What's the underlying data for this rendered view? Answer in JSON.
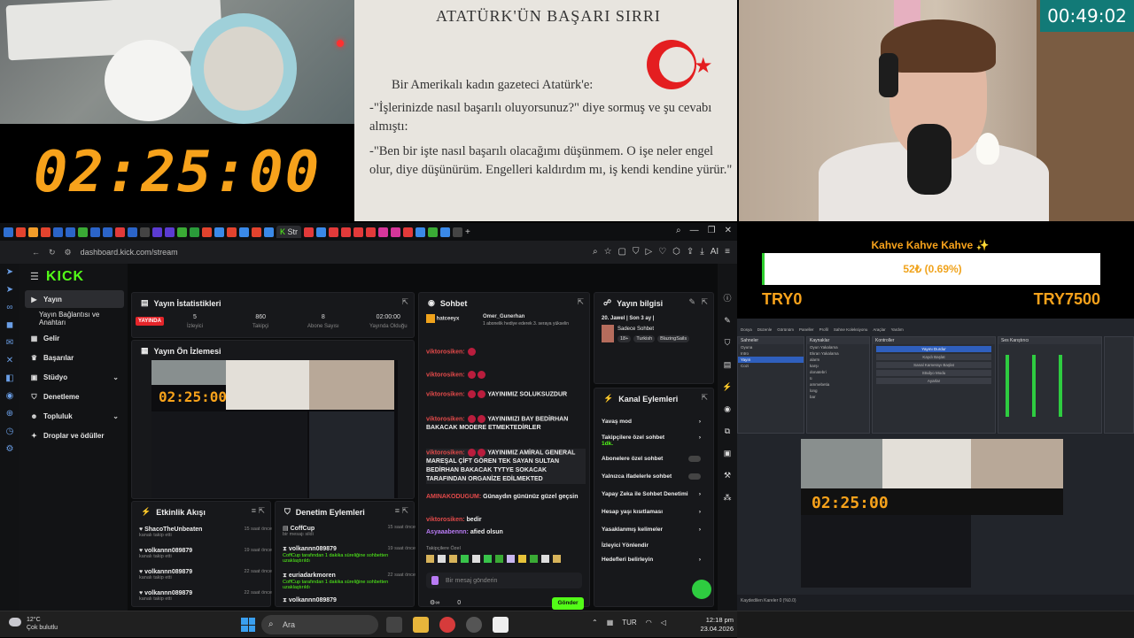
{
  "overlay": {
    "big_timer": "02:25:00",
    "small_clock": "00:49:02",
    "book": {
      "title": "ATATÜRK'ÜN BAŞARI SIRRI",
      "p1": "Bir Amerikalı kadın gazeteci Atatürk'e:",
      "p2": "-\"İşlerinizde nasıl başarılı oluyorsunuz?\" diye sormuş ve şu cevabı almıştı:",
      "p3": "-\"Ben bir işte nasıl başarılı olacağımı düşünmem. O işe neler engel olur, diye düşünürüm. Engelleri kaldırdım mı, iş kendi kendine yürür.\""
    },
    "donation": {
      "title": "Kahve Kahve Kahve ✨",
      "progress_text": "52₺ (0.69%)",
      "progress_fraction": 0.0069,
      "min_label": "TRY0",
      "max_label": "TRY7500"
    }
  },
  "browser": {
    "active_tab": "Str",
    "url": "dashboard.kick.com/stream",
    "logo": "KICK",
    "sidebar": {
      "items": [
        {
          "label": "Yayın",
          "icon": "play-icon",
          "active": true
        },
        {
          "label": "Yayın Bağlantısı ve Anahtarı",
          "icon": "",
          "active": false
        },
        {
          "label": "Gelir",
          "icon": "money-icon",
          "active": false
        },
        {
          "label": "Başarılar",
          "icon": "trophy-icon",
          "active": false
        },
        {
          "label": "Stüdyo",
          "icon": "studio-icon",
          "active": false
        },
        {
          "label": "Denetleme",
          "icon": "shield-icon",
          "active": false
        },
        {
          "label": "Topluluk",
          "icon": "users-icon",
          "active": false
        },
        {
          "label": "Droplar ve ödüller",
          "icon": "gift-icon",
          "active": false
        }
      ]
    },
    "stats": {
      "title": "Yayın İstatistikleri",
      "live": "YAYINDA",
      "items": [
        {
          "value": "5",
          "label": "İzleyici"
        },
        {
          "value": "860",
          "label": "Takipçi"
        },
        {
          "value": "8",
          "label": "Abone Sayısı"
        },
        {
          "value": "02:00:00",
          "label": "Yayında Olduğu"
        }
      ]
    },
    "preview": {
      "title": "Yayın Ön İzlemesi",
      "timer": "02:25:00"
    },
    "chat": {
      "title": "Sohbet",
      "pinned_user": "hatceeyx",
      "pinned_user2": "Omer_Gunerhan",
      "pinned_text": "1 abonelik hediye ederek 3. seraya yükselin",
      "messages": [
        {
          "user": "viktorosiken:",
          "text": "",
          "color": "r"
        },
        {
          "user": "viktorosiken:",
          "text": "",
          "color": "r"
        },
        {
          "user": "viktorosiken:",
          "text": "YAYINIMIZ SOLUKSUZDUR",
          "color": "r"
        },
        {
          "user": "viktorosiken:",
          "text": "YAYINIMIZI BAY BEDİRHAN BAKACAK MODERE ETMEKTEDİRLER",
          "color": "r"
        },
        {
          "user": "viktorosiken:",
          "text": "YAYINIMIZ AMİRAL GENERAL MAREŞAL ÇİFT GÖREN TEK SAYAN SULTAN BEDİRHAN BAKACAK TYTYE SOKACAK TARAFINDAN ORGANİZE EDİLMEKTED",
          "color": "r"
        },
        {
          "user": "AMINAKODUGUM:",
          "text": "Günaydın gününüz güzel geçsin",
          "color": "r"
        },
        {
          "user": "viktorosiken:",
          "text": "bedir",
          "color": "r"
        },
        {
          "user": "Asyaaabennn:",
          "text": "afied olsun",
          "color": "p"
        }
      ],
      "followers_only": "Takipçilere Özel",
      "placeholder": "Bir mesaj gönderin",
      "send": "Gönder",
      "count": "0"
    },
    "stream_info": {
      "title": "Yayın bilgisi",
      "stream_title": "20. Jawel | Son 3 ay |",
      "category": "Sadece Sohbet",
      "tags": [
        "18+",
        "Turkish",
        "BlazingSails"
      ]
    },
    "channel_actions": {
      "title": "Kanal Eylemleri",
      "items": [
        {
          "label": "Yavaş mod",
          "kind": "chevron"
        },
        {
          "label": "Takipçilere özel sohbet",
          "sub": "1dk.",
          "kind": "chevron"
        },
        {
          "label": "Abonelere özel sohbet",
          "kind": "toggle"
        },
        {
          "label": "Yalnızca ifadelerle sohbet",
          "kind": "toggle"
        },
        {
          "label": "Yapay Zeka ile Sohbet Denetimi",
          "kind": "chevron"
        },
        {
          "label": "Hesap yaşı kısıtlaması",
          "kind": "chevron"
        },
        {
          "label": "Yasaklanmış kelimeler",
          "kind": "chevron"
        },
        {
          "label": "İzleyici Yönlendir",
          "kind": "none"
        },
        {
          "label": "Hedefleri belirleyin",
          "kind": "chevron"
        }
      ]
    },
    "activity": {
      "title": "Etkinlik Akışı",
      "items": [
        {
          "user": "ShacoTheUnbeaten",
          "sub": "kanalı takip etti",
          "time": "15 saat önce"
        },
        {
          "user": "volkannn089879",
          "sub": "kanalı takip etti",
          "time": "19 saat önce"
        },
        {
          "user": "volkannn089879",
          "sub": "kanalı takip etti",
          "time": "22 saat önce"
        },
        {
          "user": "volkannn089879",
          "sub": "kanalı takip etti",
          "time": "22 saat önce"
        }
      ]
    },
    "mod": {
      "title": "Denetim Eylemleri",
      "items": [
        {
          "user": "CoffCup",
          "sub": "bir mesajı sildi",
          "time": "15 saat önce"
        },
        {
          "user": "volkannn089879",
          "sub": "CoffCup tarafından 1 dakika süreliğine sohbetten uzaklaştırıldı",
          "time": "19 saat önce"
        },
        {
          "user": "euriadarkmoren",
          "sub": "CoffCup tarafından 1 dakika süreliğine sohbetten uzaklaştırıldı",
          "time": "22 saat önce"
        },
        {
          "user": "volkannn089879",
          "sub": "",
          "time": ""
        }
      ]
    }
  },
  "obs": {
    "menu": [
      "Dosya",
      "Düzenle",
      "Görünüm",
      "Paneller",
      "Profil",
      "Sahne Koleksiyonu",
      "Araçlar",
      "Yardım"
    ],
    "scenes_title": "Sahneler",
    "scenes": [
      "Oyuna",
      "Intro",
      "Yayın",
      "Cozi"
    ],
    "sources_title": "Kaynaklar",
    "sources": [
      "Oyun Yakalama",
      "Ekran Yakalama",
      "alarm",
      "karşı",
      "donatebri",
      "ü",
      "ammebetia",
      "long",
      "bar"
    ],
    "controls_title": "Kontroller",
    "controls": [
      "Yayını Durdur",
      "Kaydı Başlat",
      "Sanal Kamerayı Başlat",
      "Stüdyo Modu",
      "Ayarlar"
    ],
    "mixer_title": "Ses Karıştırıcı",
    "status": "Kaydedilen Kareler 0 (%0.0)"
  },
  "taskbar": {
    "weather_temp": "12°C",
    "weather_desc": "Çok bulutlu",
    "search": "Ara",
    "lang": "TUR",
    "time": "12:18 pm",
    "date": "23.04.2026"
  }
}
